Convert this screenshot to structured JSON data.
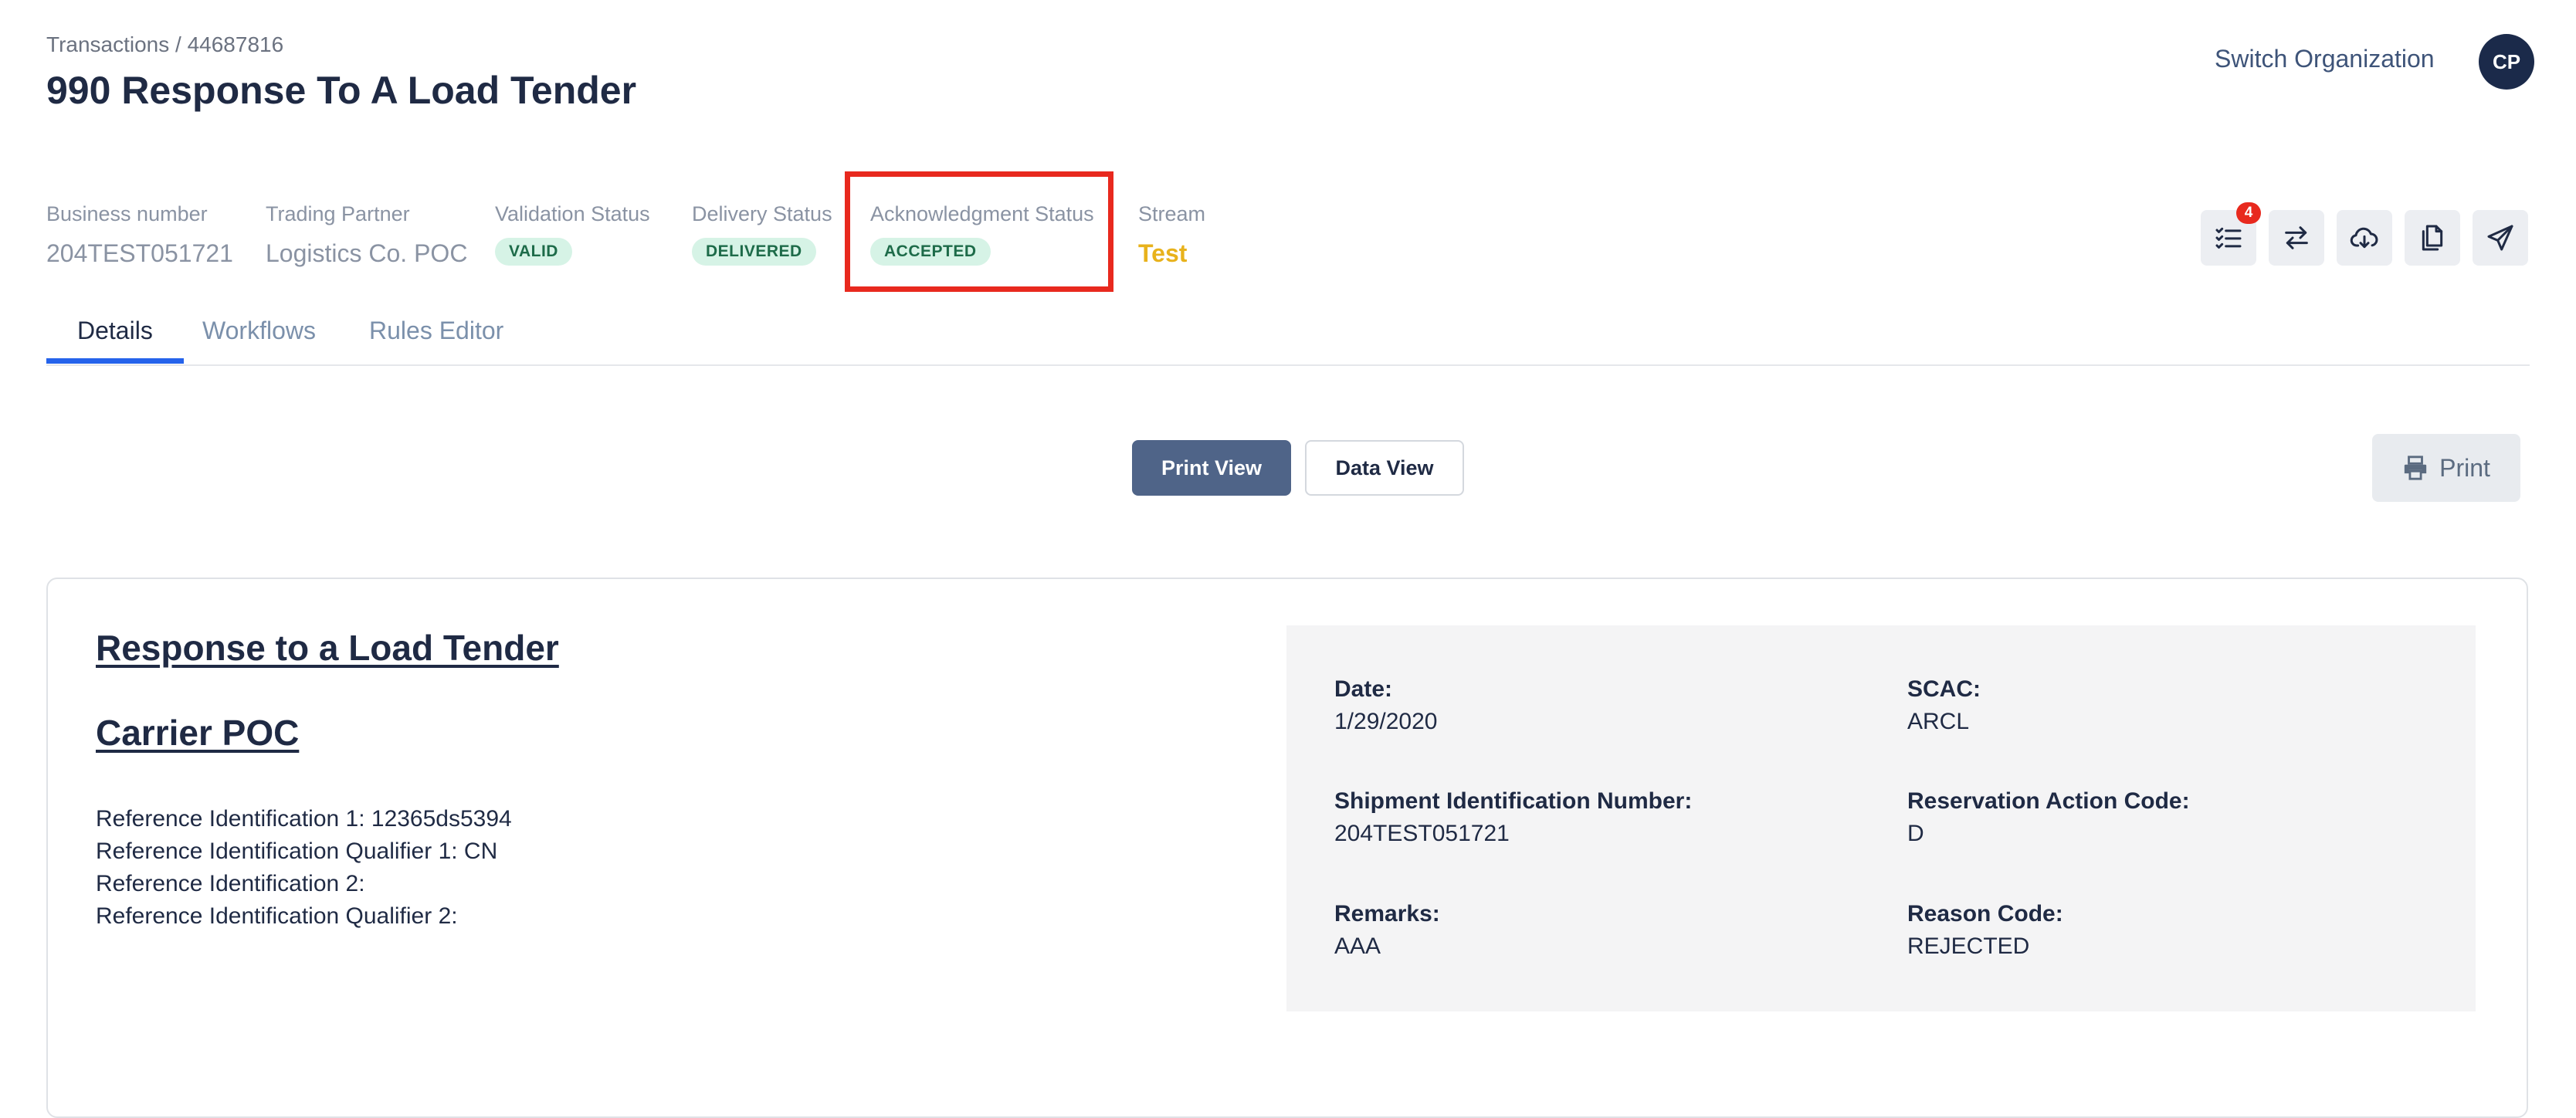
{
  "header": {
    "breadcrumb": "Transactions / 44687816",
    "title": "990 Response To A Load Tender",
    "switch_org_label": "Switch Organization",
    "avatar_initials": "CP"
  },
  "meta": {
    "business_number_label": "Business number",
    "business_number_value": "204TEST051721",
    "trading_partner_label": "Trading Partner",
    "trading_partner_value": "Logistics Co. POC",
    "validation_status_label": "Validation Status",
    "validation_status_value": "VALID",
    "delivery_status_label": "Delivery Status",
    "delivery_status_value": "DELIVERED",
    "ack_status_label": "Acknowledgment Status",
    "ack_status_value": "ACCEPTED",
    "stream_label": "Stream",
    "stream_value": "Test"
  },
  "actions": {
    "checklist_count": "4",
    "icons": [
      "checklist-icon",
      "swap-icon",
      "cloud-download-icon",
      "copy-icon",
      "send-icon"
    ]
  },
  "tabs": [
    {
      "label": "Details",
      "active": true
    },
    {
      "label": "Workflows",
      "active": false
    },
    {
      "label": "Rules Editor",
      "active": false
    }
  ],
  "views": {
    "print_view_label": "Print View",
    "data_view_label": "Data View",
    "print_label": "Print"
  },
  "document": {
    "title": "Response to a Load Tender",
    "subtitle": "Carrier POC",
    "reference_lines": [
      "Reference Identification 1: 12365ds5394",
      "Reference Identification Qualifier 1: CN",
      "Reference Identification 2:",
      "Reference Identification Qualifier 2:"
    ],
    "fields": {
      "date_label": "Date:",
      "date_value": "1/29/2020",
      "scac_label": "SCAC:",
      "scac_value": "ARCL",
      "shipment_id_label": "Shipment Identification Number:",
      "shipment_id_value": "204TEST051721",
      "reservation_label": "Reservation Action Code:",
      "reservation_value": "D",
      "remarks_label": "Remarks:",
      "remarks_value": "AAA",
      "reason_label": "Reason Code:",
      "reason_value": "REJECTED"
    }
  },
  "colors": {
    "primary": "#4f6488",
    "tab_accent": "#2563eb",
    "highlight": "#e8291e",
    "stream": "#e8b21c",
    "badge_bg": "#d6f3e6",
    "badge_text": "#1d6b49"
  }
}
